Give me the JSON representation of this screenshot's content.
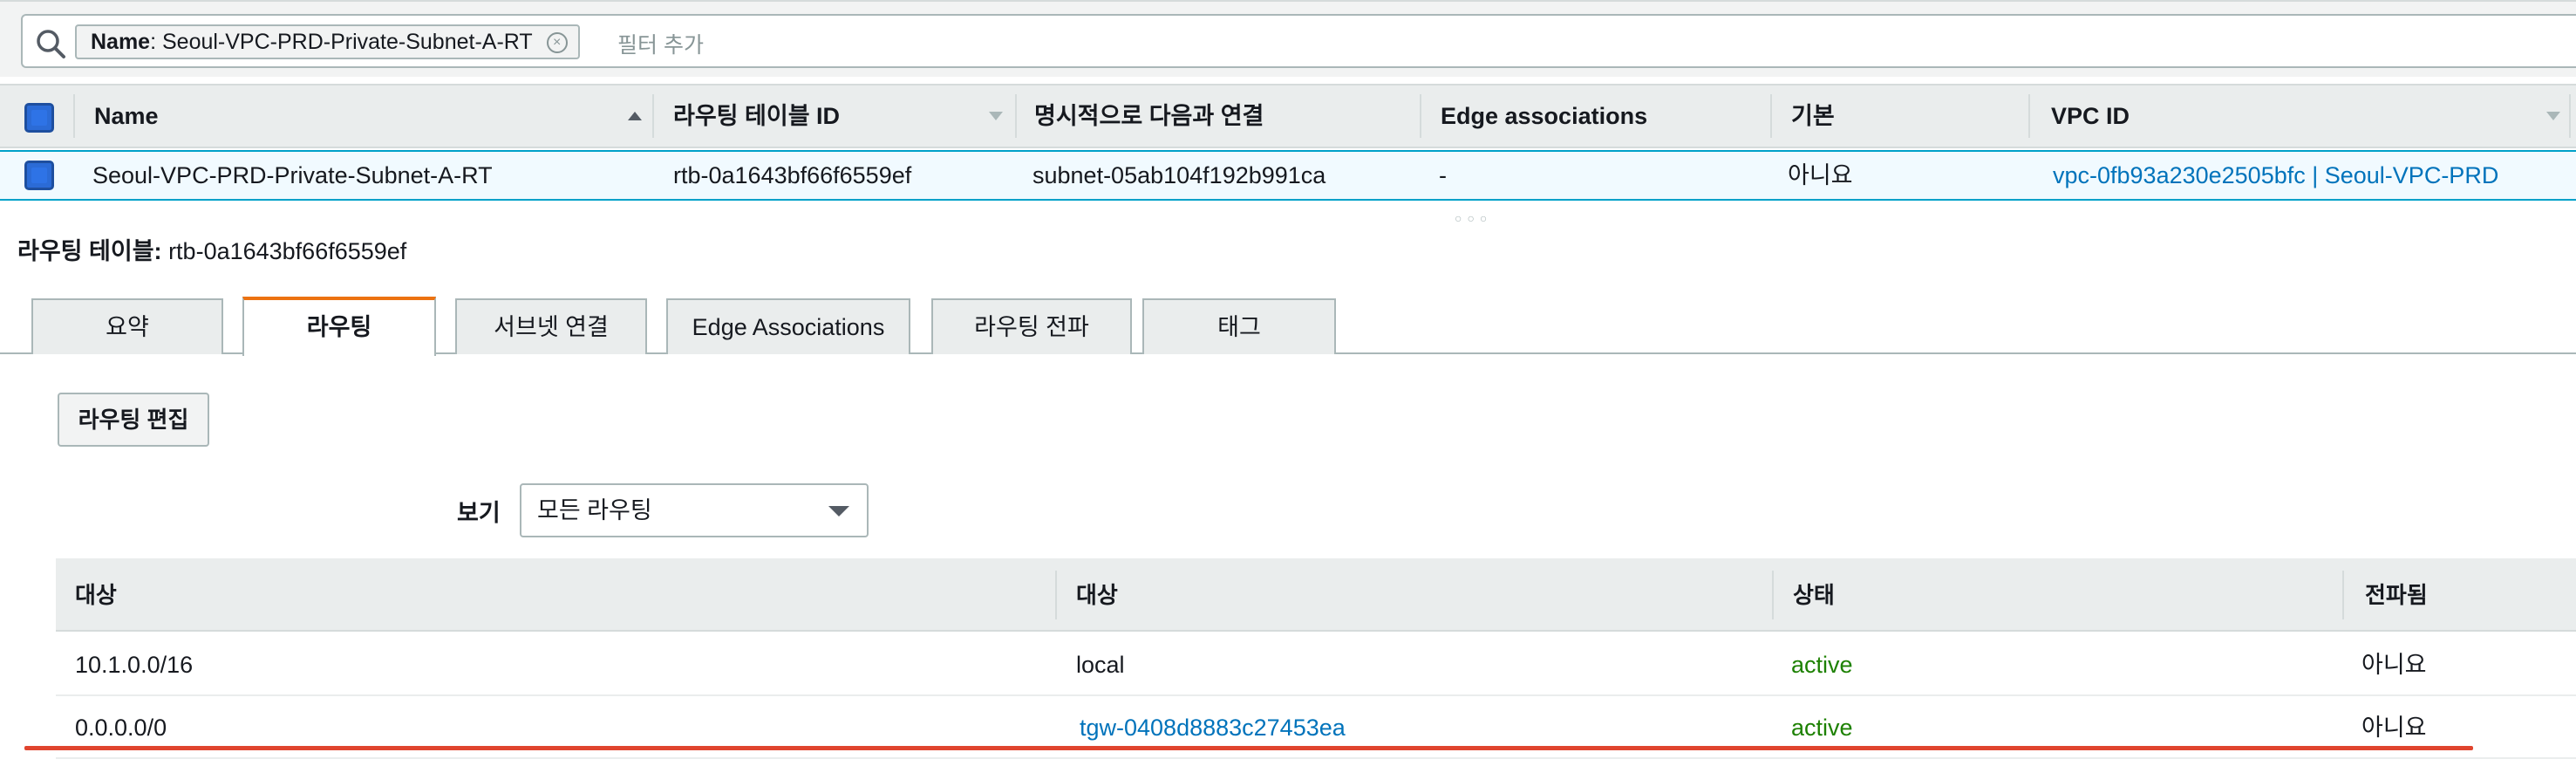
{
  "filter": {
    "token_key": "Name",
    "token_value": ": Seoul-VPC-PRD-Private-Subnet-A-RT",
    "add_filter_placeholder": "필터 추가"
  },
  "grid": {
    "columns": [
      "Name",
      "라우팅 테이블 ID",
      "명시적으로 다음과 연결",
      "Edge associations",
      "기본",
      "VPC ID"
    ],
    "row": {
      "name": "Seoul-VPC-PRD-Private-Subnet-A-RT",
      "route_table_id": "rtb-0a1643bf66f6559ef",
      "explicit_association": "subnet-05ab104f192b991ca",
      "edge_associations": "-",
      "main": "아니요",
      "vpc_id": "vpc-0fb93a230e2505bfc | Seoul-VPC-PRD"
    }
  },
  "detail": {
    "title_label": "라우팅 테이블:",
    "title_value": "rtb-0a1643bf66f6559ef",
    "tabs": [
      {
        "label": "요약",
        "active": false
      },
      {
        "label": "라우팅",
        "active": true
      },
      {
        "label": "서브넷 연결",
        "active": false
      },
      {
        "label": "Edge Associations",
        "active": false
      },
      {
        "label": "라우팅 전파",
        "active": false
      },
      {
        "label": "태그",
        "active": false
      }
    ],
    "edit_button": "라우팅 편집",
    "view_label": "보기",
    "view_select": "모든 라우팅"
  },
  "routes": {
    "columns": [
      "대상",
      "대상",
      "상태",
      "전파됨"
    ],
    "rows": [
      {
        "destination": "10.1.0.0/16",
        "target": "local",
        "status": "active",
        "propagated": "아니요"
      },
      {
        "destination": "0.0.0.0/0",
        "target": "tgw-0408d8883c27453ea",
        "status": "active",
        "propagated": "아니요"
      }
    ]
  },
  "colors": {
    "link": "#0073bb",
    "status_active": "#1d8102",
    "tab_accent": "#ec7211",
    "highlight_underline": "#e0442e",
    "checkbox": "#2e73e6"
  }
}
